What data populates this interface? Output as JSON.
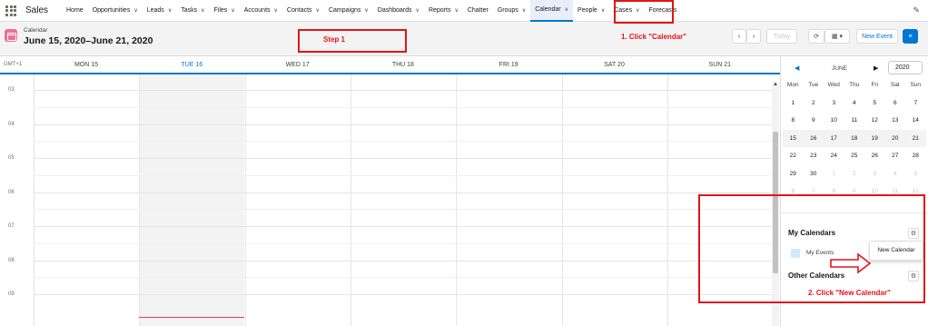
{
  "app": {
    "name": "Sales"
  },
  "nav": {
    "items": [
      {
        "label": "Home",
        "chevron": false
      },
      {
        "label": "Opportunities",
        "chevron": true
      },
      {
        "label": "Leads",
        "chevron": true
      },
      {
        "label": "Tasks",
        "chevron": true
      },
      {
        "label": "Files",
        "chevron": true
      },
      {
        "label": "Accounts",
        "chevron": true
      },
      {
        "label": "Contacts",
        "chevron": true
      },
      {
        "label": "Campaigns",
        "chevron": true
      },
      {
        "label": "Dashboards",
        "chevron": true
      },
      {
        "label": "Reports",
        "chevron": true
      },
      {
        "label": "Chatter",
        "chevron": false
      },
      {
        "label": "Groups",
        "chevron": true
      },
      {
        "label": "Calendar",
        "chevron": true,
        "active": true
      },
      {
        "label": "People",
        "chevron": true
      },
      {
        "label": "Cases",
        "chevron": true
      },
      {
        "label": "Forecasts",
        "chevron": false
      }
    ]
  },
  "header": {
    "object_label": "Calendar",
    "date_range": "June 15, 2020–June 21, 2020",
    "today_label": "Today",
    "new_event_label": "New Event"
  },
  "week": {
    "timezone": "GMT+1",
    "days": [
      {
        "label": "MON 15"
      },
      {
        "label": "TUE 16",
        "today": true
      },
      {
        "label": "WED 17"
      },
      {
        "label": "THU 18"
      },
      {
        "label": "FRI 19"
      },
      {
        "label": "SAT 20"
      },
      {
        "label": "SUN 21"
      }
    ],
    "hours": [
      "03",
      "04",
      "05",
      "06",
      "07",
      "08",
      "09"
    ]
  },
  "mini_calendar": {
    "month": "JUNE",
    "year": "2020",
    "weekdays": [
      "Mon",
      "Tue",
      "Wed",
      "Thu",
      "Fri",
      "Sat",
      "Sun"
    ],
    "weeks": [
      [
        "1",
        "2",
        "3",
        "4",
        "5",
        "6",
        "7"
      ],
      [
        "8",
        "9",
        "10",
        "11",
        "12",
        "13",
        "14"
      ],
      [
        "15",
        "16",
        "17",
        "18",
        "19",
        "20",
        "21"
      ],
      [
        "22",
        "23",
        "24",
        "25",
        "26",
        "27",
        "28"
      ],
      [
        "29",
        "30",
        "1",
        "2",
        "3",
        "4",
        "5"
      ],
      [
        "6",
        "7",
        "8",
        "9",
        "10",
        "11",
        "12"
      ]
    ]
  },
  "my_calendars": {
    "title": "My Calendars",
    "items": [
      {
        "label": "My Events",
        "color": "#cfe9fe"
      }
    ],
    "menu_item": "New Calendar"
  },
  "other_calendars": {
    "title": "Other Calendars"
  },
  "annotations": {
    "step1": "Step 1",
    "click_calendar": "1. Click \"Calendar\"",
    "click_new_calendar": "2. Click \"New Calendar\""
  },
  "colors": {
    "brand_blue": "#0176d3",
    "annotation_red": "#e2131a",
    "calendar_icon": "#eb7092"
  }
}
